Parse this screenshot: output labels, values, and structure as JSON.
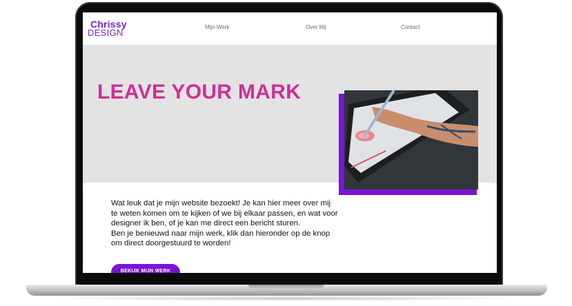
{
  "logo": {
    "line1": "Chrissy",
    "line2": "DESIGN"
  },
  "nav": {
    "items": [
      {
        "label": "Mijn Werk"
      },
      {
        "label": "Over Mij"
      },
      {
        "label": "Contact"
      }
    ]
  },
  "hero": {
    "title": "LEAVE YOUR MARK"
  },
  "intro": {
    "paragraph1": "Wat leuk dat je mijn website bezoekt! Je kan hier meer over mij te weten komen om te kijken of we bij elkaar passen, en wat voor designer ik ben, of je kan me direct een bericht sturen.",
    "paragraph2": "Ben je benieuwd naar mijn werk, klik dan hieronder op de knop om direct doorgestuurd te worden!"
  },
  "cta": {
    "label": "BEKIJK MIJN WERK"
  },
  "colors": {
    "brand_purple": "#7a14d6",
    "title_pink": "#cf2e96",
    "hero_background": "#e3e3e3"
  }
}
